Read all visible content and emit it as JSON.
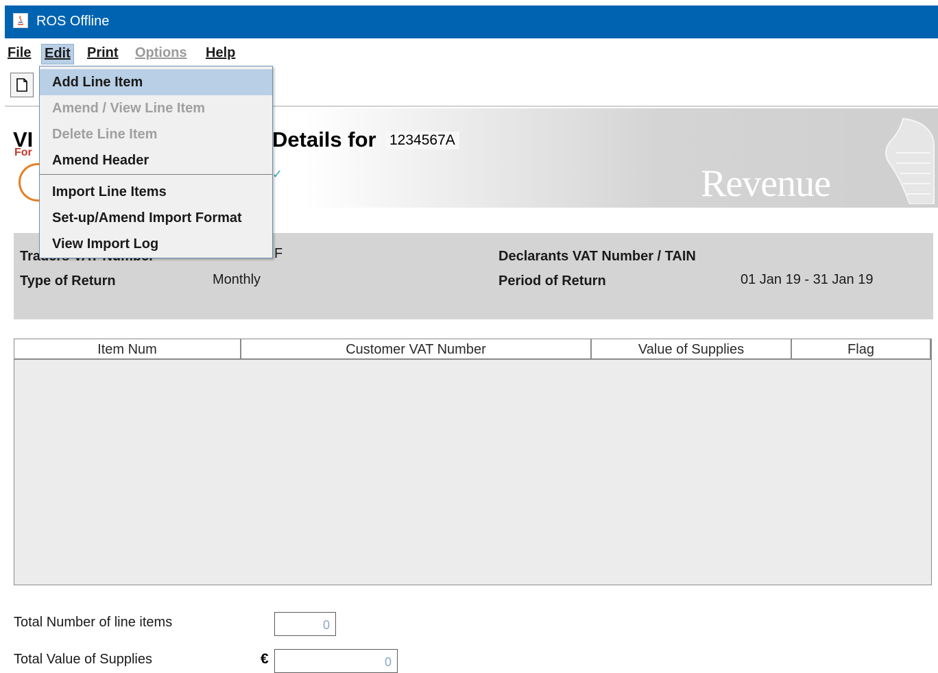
{
  "window": {
    "title": "ROS Offline"
  },
  "menubar": {
    "file": "File",
    "edit": "Edit",
    "print": "Print",
    "options": "Options",
    "help": "Help"
  },
  "edit_menu": {
    "items": [
      {
        "label": "Add Line Item",
        "enabled": true,
        "highlighted": true
      },
      {
        "label": "Amend / View Line Item",
        "enabled": false
      },
      {
        "label": "Delete Line Item",
        "enabled": false
      },
      {
        "label": "Amend Header",
        "enabled": true
      },
      {
        "label": "Import Line Items",
        "enabled": true
      },
      {
        "label": "Set-up/Amend Import Format",
        "enabled": true
      },
      {
        "label": "View Import Log",
        "enabled": true
      }
    ]
  },
  "banner": {
    "title_left": "VI",
    "title_right": "Details for",
    "vat_number": "1234567A",
    "form_label": "For",
    "logo_text": "Revenue"
  },
  "header": {
    "traders_vat_label": "Traders VAT Number",
    "traders_vat_value": "F",
    "declarants_vat_label": "Declarants VAT Number / TAIN",
    "type_of_return_label": "Type of Return",
    "type_of_return_value": "Monthly",
    "period_label": "Period of Return",
    "period_value": "01 Jan 19 - 31 Jan 19"
  },
  "table": {
    "columns": [
      "Item Num",
      "Customer VAT Number",
      "Value of Supplies",
      "Flag"
    ],
    "rows": []
  },
  "totals": {
    "line_items_label": "Total Number of line items",
    "line_items_value": "0",
    "value_label": "Total Value of Supplies",
    "currency": "€",
    "value_value": "0"
  },
  "colors": {
    "titlebar": "#0063b1",
    "menu_highlight": "#b8cfe5",
    "panel": "#d4d4d4"
  }
}
